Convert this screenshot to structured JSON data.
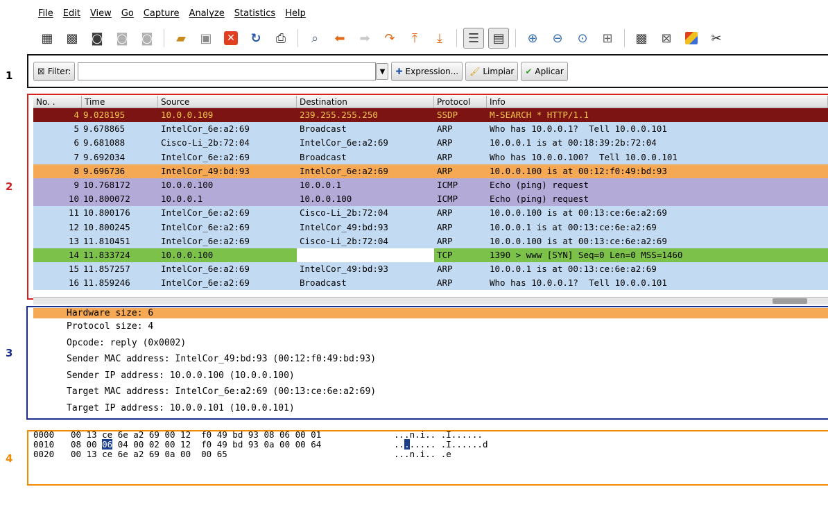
{
  "callouts": [
    "1",
    "2",
    "3",
    "4"
  ],
  "menu": [
    "File",
    "Edit",
    "View",
    "Go",
    "Capture",
    "Analyze",
    "Statistics",
    "Help"
  ],
  "toolbar_icons": [
    "interface-list-icon",
    "capture-options-icon",
    "start-capture-icon",
    "stop-capture-icon",
    "restart-capture-icon",
    "open-file-icon",
    "save-file-icon",
    "close-file-icon",
    "reload-icon",
    "print-icon",
    "find-packet-icon",
    "go-back-icon",
    "go-forward-icon",
    "go-to-packet-icon",
    "go-first-icon",
    "go-last-icon",
    "colorize-icon",
    "auto-scroll-icon",
    "zoom-in-icon",
    "zoom-out-icon",
    "zoom-normal-icon",
    "resize-columns-icon",
    "capture-filters-icon",
    "display-filters-icon",
    "coloring-rules-icon",
    "preferences-icon"
  ],
  "filter": {
    "label": "Filter:",
    "value": "",
    "expression": "Expression...",
    "clear": "Limpiar",
    "apply": "Aplicar"
  },
  "packet_list": {
    "columns": [
      "No. .",
      "Time",
      "Source",
      "Destination",
      "Protocol",
      "Info"
    ],
    "rows": [
      {
        "no": "4",
        "time": "9.028195",
        "src": "10.0.0.109",
        "dst": "239.255.255.250",
        "proto": "SSDP",
        "info": "M-SEARCH * HTTP/1.1",
        "bg": "#7d1414",
        "fg": "#f4c84a"
      },
      {
        "no": "5",
        "time": "9.678865",
        "src": "IntelCor_6e:a2:69",
        "dst": "Broadcast",
        "proto": "ARP",
        "info": "Who has 10.0.0.1?  Tell 10.0.0.101",
        "bg": "#c3dbf2",
        "fg": "#000000"
      },
      {
        "no": "6",
        "time": "9.681088",
        "src": "Cisco-Li_2b:72:04",
        "dst": "IntelCor_6e:a2:69",
        "proto": "ARP",
        "info": "10.0.0.1 is at 00:18:39:2b:72:04",
        "bg": "#c3dbf2",
        "fg": "#000000"
      },
      {
        "no": "7",
        "time": "9.692034",
        "src": "IntelCor_6e:a2:69",
        "dst": "Broadcast",
        "proto": "ARP",
        "info": "Who has 10.0.0.100?  Tell 10.0.0.101",
        "bg": "#c3dbf2",
        "fg": "#000000"
      },
      {
        "no": "8",
        "time": "9.696736",
        "src": "IntelCor_49:bd:93",
        "dst": "IntelCor_6e:a2:69",
        "proto": "ARP",
        "info": "10.0.0.100 is at 00:12:f0:49:bd:93",
        "bg": "#f6a955",
        "fg": "#000000"
      },
      {
        "no": "9",
        "time": "10.768172",
        "src": "10.0.0.100",
        "dst": "10.0.0.1",
        "proto": "ICMP",
        "info": "Echo (ping) request",
        "bg": "#b3aad8",
        "fg": "#000000"
      },
      {
        "no": "10",
        "time": "10.800072",
        "src": "10.0.0.1",
        "dst": "10.0.0.100",
        "proto": "ICMP",
        "info": "Echo (ping) request",
        "bg": "#b3aad8",
        "fg": "#000000"
      },
      {
        "no": "11",
        "time": "10.800176",
        "src": "IntelCor_6e:a2:69",
        "dst": "Cisco-Li_2b:72:04",
        "proto": "ARP",
        "info": "10.0.0.100 is at 00:13:ce:6e:a2:69",
        "bg": "#c3dbf2",
        "fg": "#000000"
      },
      {
        "no": "12",
        "time": "10.800245",
        "src": "IntelCor_6e:a2:69",
        "dst": "IntelCor_49:bd:93",
        "proto": "ARP",
        "info": "10.0.0.1 is at 00:13:ce:6e:a2:69",
        "bg": "#c3dbf2",
        "fg": "#000000"
      },
      {
        "no": "13",
        "time": "11.810451",
        "src": "IntelCor_6e:a2:69",
        "dst": "Cisco-Li_2b:72:04",
        "proto": "ARP",
        "info": "10.0.0.100 is at 00:13:ce:6e:a2:69",
        "bg": "#c3dbf2",
        "fg": "#000000"
      },
      {
        "no": "14",
        "time": "11.833724",
        "src": "10.0.0.100",
        "dst": "",
        "proto": "TCP",
        "info": "1390 > www [SYN] Seq=0 Len=0 MSS=1460",
        "bg": "#7cc24a",
        "fg": "#000000"
      },
      {
        "no": "15",
        "time": "11.857257",
        "src": "IntelCor_6e:a2:69",
        "dst": "IntelCor_49:bd:93",
        "proto": "ARP",
        "info": "10.0.0.1 is at 00:13:ce:6e:a2:69",
        "bg": "#c3dbf2",
        "fg": "#000000"
      },
      {
        "no": "16",
        "time": "11.859246",
        "src": "IntelCor_6e:a2:69",
        "dst": "Broadcast",
        "proto": "ARP",
        "info": "Who has 10.0.0.1?  Tell 10.0.0.101",
        "bg": "#c3dbf2",
        "fg": "#000000"
      }
    ]
  },
  "details": [
    "Hardware size: 6",
    "Protocol size: 4",
    "Opcode: reply (0x0002)",
    "Sender MAC address: IntelCor_49:bd:93 (00:12:f0:49:bd:93)",
    "Sender IP address: 10.0.0.100 (10.0.0.100)",
    "Target MAC address: IntelCor_6e:a2:69 (00:13:ce:6e:a2:69)",
    "Target IP address: 10.0.0.101 (10.0.0.101)"
  ],
  "bytes": [
    {
      "off": "0000",
      "hex_a": "00 13 ce 6e a2 69 00 12  f0 49 bd 93 08 06 00 01",
      "hex_hl": "",
      "hex_b": "",
      "asc_a": "...n.i.. .I......",
      "asc_hl": "",
      "asc_b": ""
    },
    {
      "off": "0010",
      "hex_a": "08 00 ",
      "hex_hl": "06",
      "hex_b": " 04 00 02 00 12  f0 49 bd 93 0a 00 00 64",
      "asc_a": "..",
      "asc_hl": ".",
      "asc_b": "..... .I......d"
    },
    {
      "off": "0020",
      "hex_a": "00 13 ce 6e a2 69 0a 00  00 65",
      "hex_hl": "",
      "hex_b": "",
      "asc_a": "...n.i.. .e",
      "asc_hl": "",
      "asc_b": ""
    }
  ]
}
